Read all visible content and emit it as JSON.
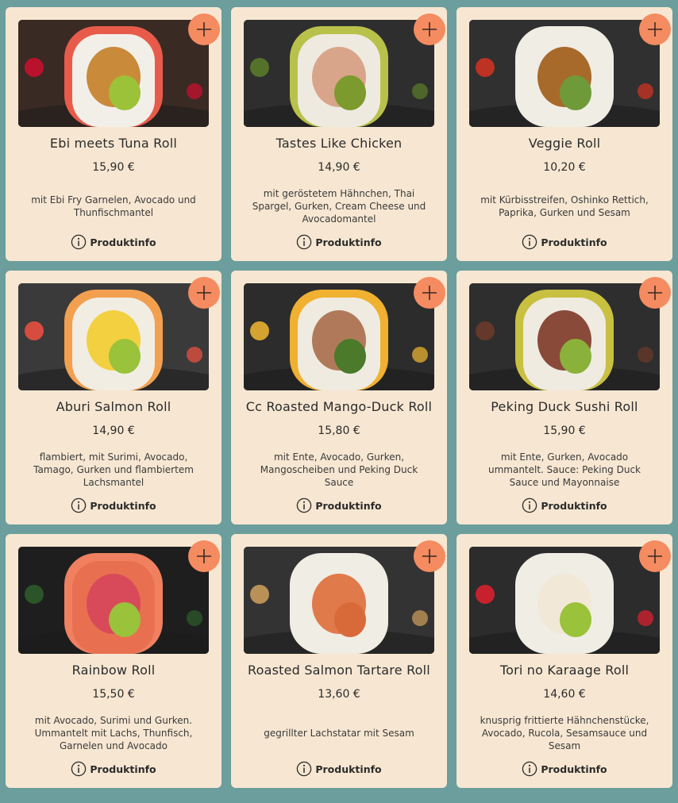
{
  "products": [
    {
      "name": "Ebi meets Tuna Roll",
      "price": "15,90 €",
      "description": "mit Ebi Fry Garnelen, Avocado und Thunfischmantel",
      "info_label": "Produktinfo",
      "image": {
        "bg": "#3a2a24",
        "wrap": "#e85b4a",
        "rice": "#f2efe8",
        "center1": "#c98a3a",
        "center2": "#9cc23a",
        "accent": "#c8102e"
      }
    },
    {
      "name": "Tastes Like Chicken",
      "price": "14,90 €",
      "description": "mit geröstetem Hähnchen, Thai Spargel, Gurken, Cream Cheese und Avocadomantel",
      "info_label": "Produktinfo",
      "image": {
        "bg": "#2e2e2e",
        "wrap": "#b8c24a",
        "rice": "#eeeae0",
        "center1": "#d9a58a",
        "center2": "#7c9a2e",
        "accent": "#5a7a2a"
      }
    },
    {
      "name": "Veggie Roll",
      "price": "10,20 €",
      "description": "mit Kürbisstreifen, Oshinko Rettich, Paprika, Gurken und Sesam",
      "info_label": "Produktinfo",
      "image": {
        "bg": "#303030",
        "wrap": "#f0ede4",
        "rice": "#f0ede4",
        "center1": "#a86a2a",
        "center2": "#6e9a3a",
        "accent": "#cc3322"
      }
    },
    {
      "name": "Aburi Salmon Roll",
      "price": "14,90 €",
      "description": "flambiert, mit Surimi, Avocado, Tamago, Gurken und flambiertem Lachsmantel",
      "info_label": "Produktinfo",
      "image": {
        "bg": "#3a3a3a",
        "wrap": "#f2a050",
        "rice": "#f1ede3",
        "center1": "#f2d040",
        "center2": "#9ac23a",
        "accent": "#e85040"
      }
    },
    {
      "name": "Cc Roasted Mango-Duck Roll",
      "price": "15,80 €",
      "description": "mit Ente, Avocado, Gurken, Mangoscheiben und Peking Duck Sauce",
      "info_label": "Produktinfo",
      "image": {
        "bg": "#2c2c2c",
        "wrap": "#f0b030",
        "rice": "#efebe1",
        "center1": "#b07a5a",
        "center2": "#4a7a2a",
        "accent": "#e8b030"
      }
    },
    {
      "name": "Peking Duck Sushi Roll",
      "price": "15,90 €",
      "description": "mit Ente, Gurken, Avocado ummantelt. Sauce: Peking Duck Sauce und Mayonnaise",
      "info_label": "Produktinfo",
      "image": {
        "bg": "#2e2e2e",
        "wrap": "#c8c040",
        "rice": "#efebe1",
        "center1": "#8a4a3a",
        "center2": "#8ab23a",
        "accent": "#6a3a2a"
      }
    },
    {
      "name": "Rainbow Roll",
      "price": "15,50 €",
      "description": "mit Avocado, Surimi und Gurken. Ummantelt mit Lachs, Thunfisch, Garnelen und Avocado",
      "info_label": "Produktinfo",
      "image": {
        "bg": "#1e1e1e",
        "wrap": "#f08060",
        "rice": "#e87050",
        "center1": "#d84a5a",
        "center2": "#9ac23a",
        "accent": "#2e5a2a"
      }
    },
    {
      "name": "Roasted Salmon Tartare Roll",
      "price": "13,60 €",
      "description": "gegrillter Lachstatar mit Sesam",
      "info_label": "Produktinfo",
      "image": {
        "bg": "#333333",
        "wrap": "#f0ede4",
        "rice": "#f0ede4",
        "center1": "#e07a4a",
        "center2": "#d86a3a",
        "accent": "#c89a5a"
      }
    },
    {
      "name": "Tori no Karaage Roll",
      "price": "14,60 €",
      "description": "knusprig frittierte Hähnchenstücke, Avocado, Rucola, Sesamsauce und Sesam",
      "info_label": "Produktinfo",
      "image": {
        "bg": "#2c2c2c",
        "wrap": "#f0ede4",
        "rice": "#f0ede4",
        "center1": "#f2e8d8",
        "center2": "#9ac23a",
        "accent": "#d8202e"
      }
    }
  ]
}
